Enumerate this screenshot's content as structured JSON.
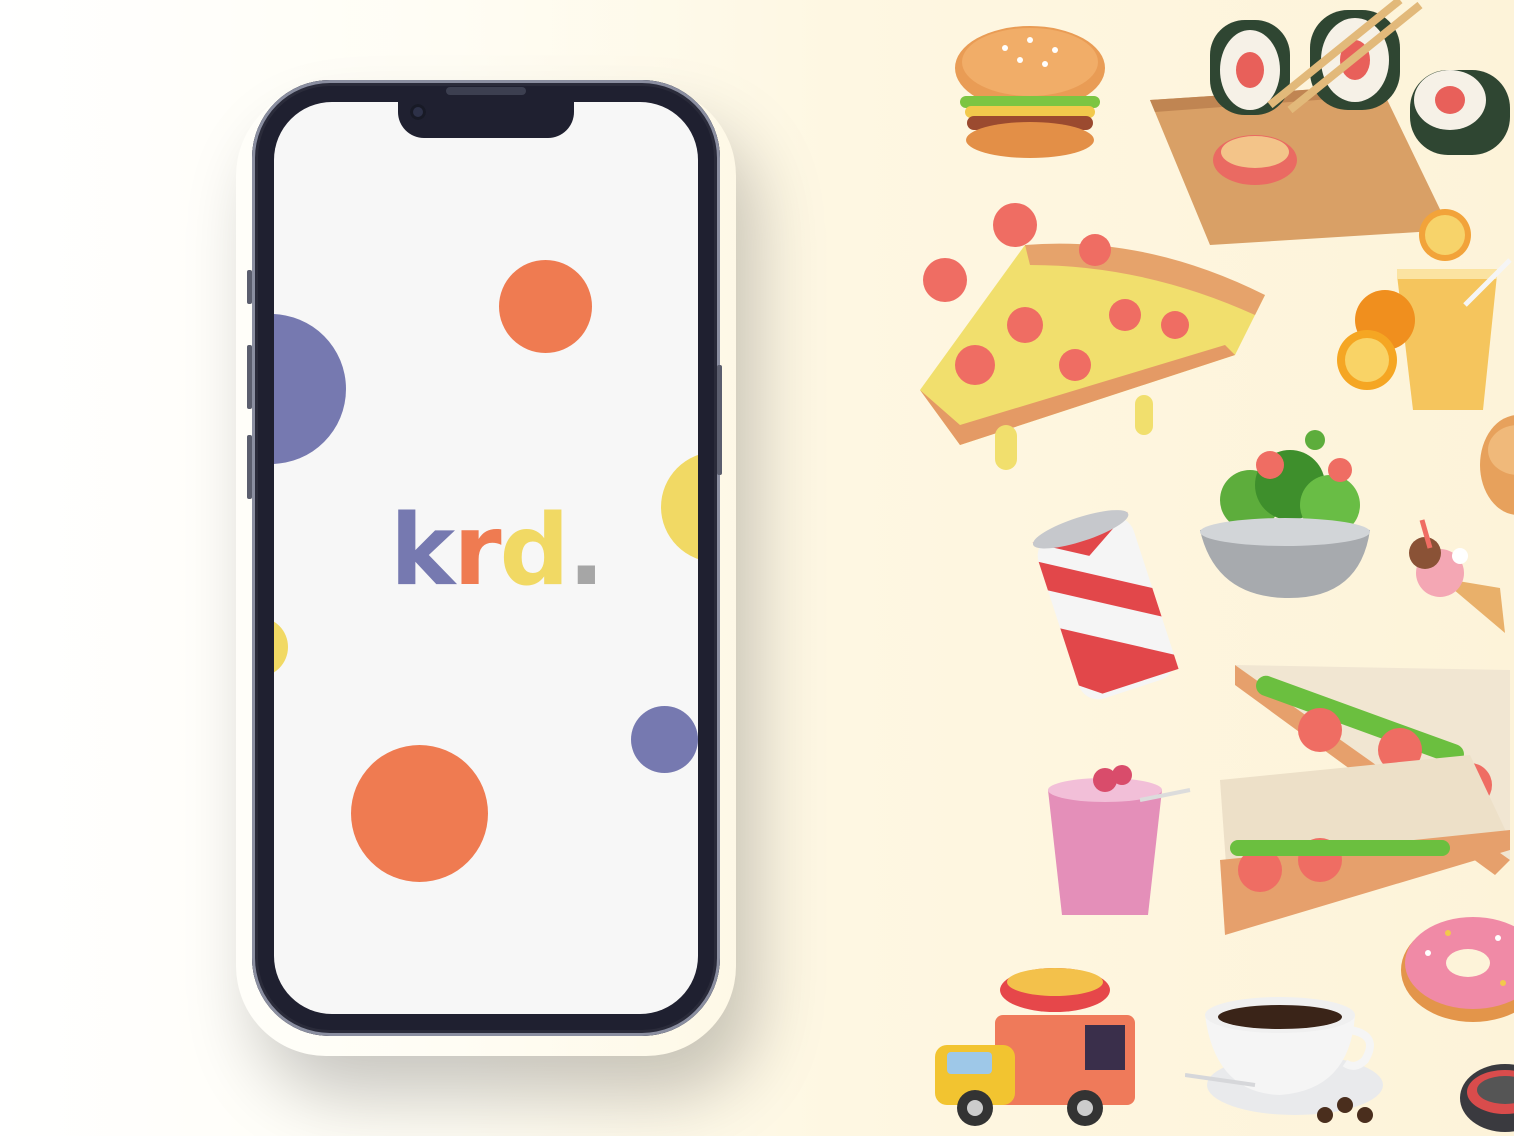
{
  "app": {
    "logo": {
      "k": "k",
      "r": "r",
      "d": "d",
      "dot": "."
    }
  },
  "colors": {
    "purple": "#7679b0",
    "orange": "#ef7b51",
    "yellow": "#f1d964",
    "gray": "#a6a6a6",
    "screen_bg": "#f7f7f7",
    "frame": "#1f2030"
  },
  "food_icons": [
    "burger-icon",
    "sushi-board-icon",
    "pizza-slice-icon",
    "orange-juice-icon",
    "salad-bowl-icon",
    "soda-can-icon",
    "ice-cream-cone-icon",
    "bowl-icon",
    "sandwich-icon",
    "smoothie-glass-icon",
    "donut-icon",
    "coffee-cup-icon",
    "food-truck-icon",
    "grill-icon"
  ]
}
